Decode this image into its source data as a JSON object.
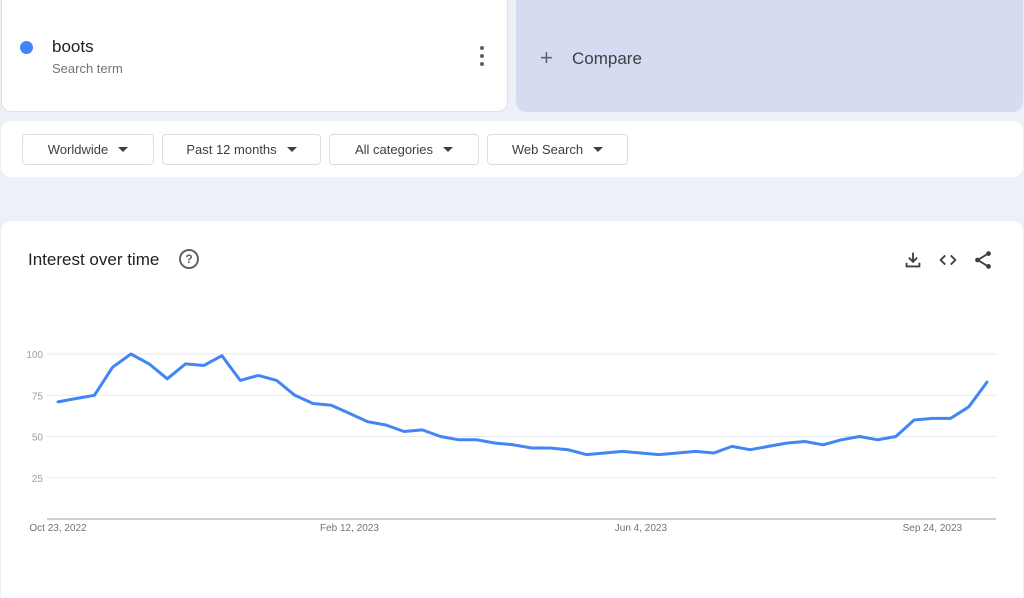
{
  "search_term": {
    "name": "boots",
    "subtitle": "Search term",
    "color": "#4285f4"
  },
  "compare": {
    "label": "Compare",
    "icon": "plus-icon"
  },
  "filters": {
    "region": "Worldwide",
    "time_range": "Past 12 months",
    "category": "All categories",
    "search_type": "Web Search"
  },
  "chart_panel": {
    "title": "Interest over time",
    "icons": [
      "help-icon",
      "download-icon",
      "embed-code-icon",
      "share-icon"
    ]
  },
  "chart_data": {
    "type": "line",
    "title": "Interest over time",
    "xlabel": "",
    "ylabel": "",
    "ylim": [
      0,
      100
    ],
    "yticks": [
      25,
      50,
      75,
      100
    ],
    "xtick_labels": [
      "Oct 23, 2022",
      "Feb 12, 2023",
      "Jun 4, 2023",
      "Sep 24, 2023"
    ],
    "xtick_index": [
      0,
      16,
      32,
      48
    ],
    "grid": true,
    "legend": false,
    "series": [
      {
        "color": "#4285f4",
        "values": [
          71,
          73,
          75,
          92,
          100,
          94,
          85,
          94,
          93,
          99,
          84,
          87,
          84,
          75,
          70,
          69,
          64,
          59,
          57,
          53,
          54,
          50,
          48,
          48,
          46,
          45,
          43,
          43,
          42,
          39,
          40,
          41,
          40,
          39,
          40,
          41,
          40,
          44,
          42,
          44,
          46,
          47,
          45,
          48,
          50,
          48,
          50,
          60,
          61,
          61,
          68,
          83
        ]
      }
    ]
  }
}
